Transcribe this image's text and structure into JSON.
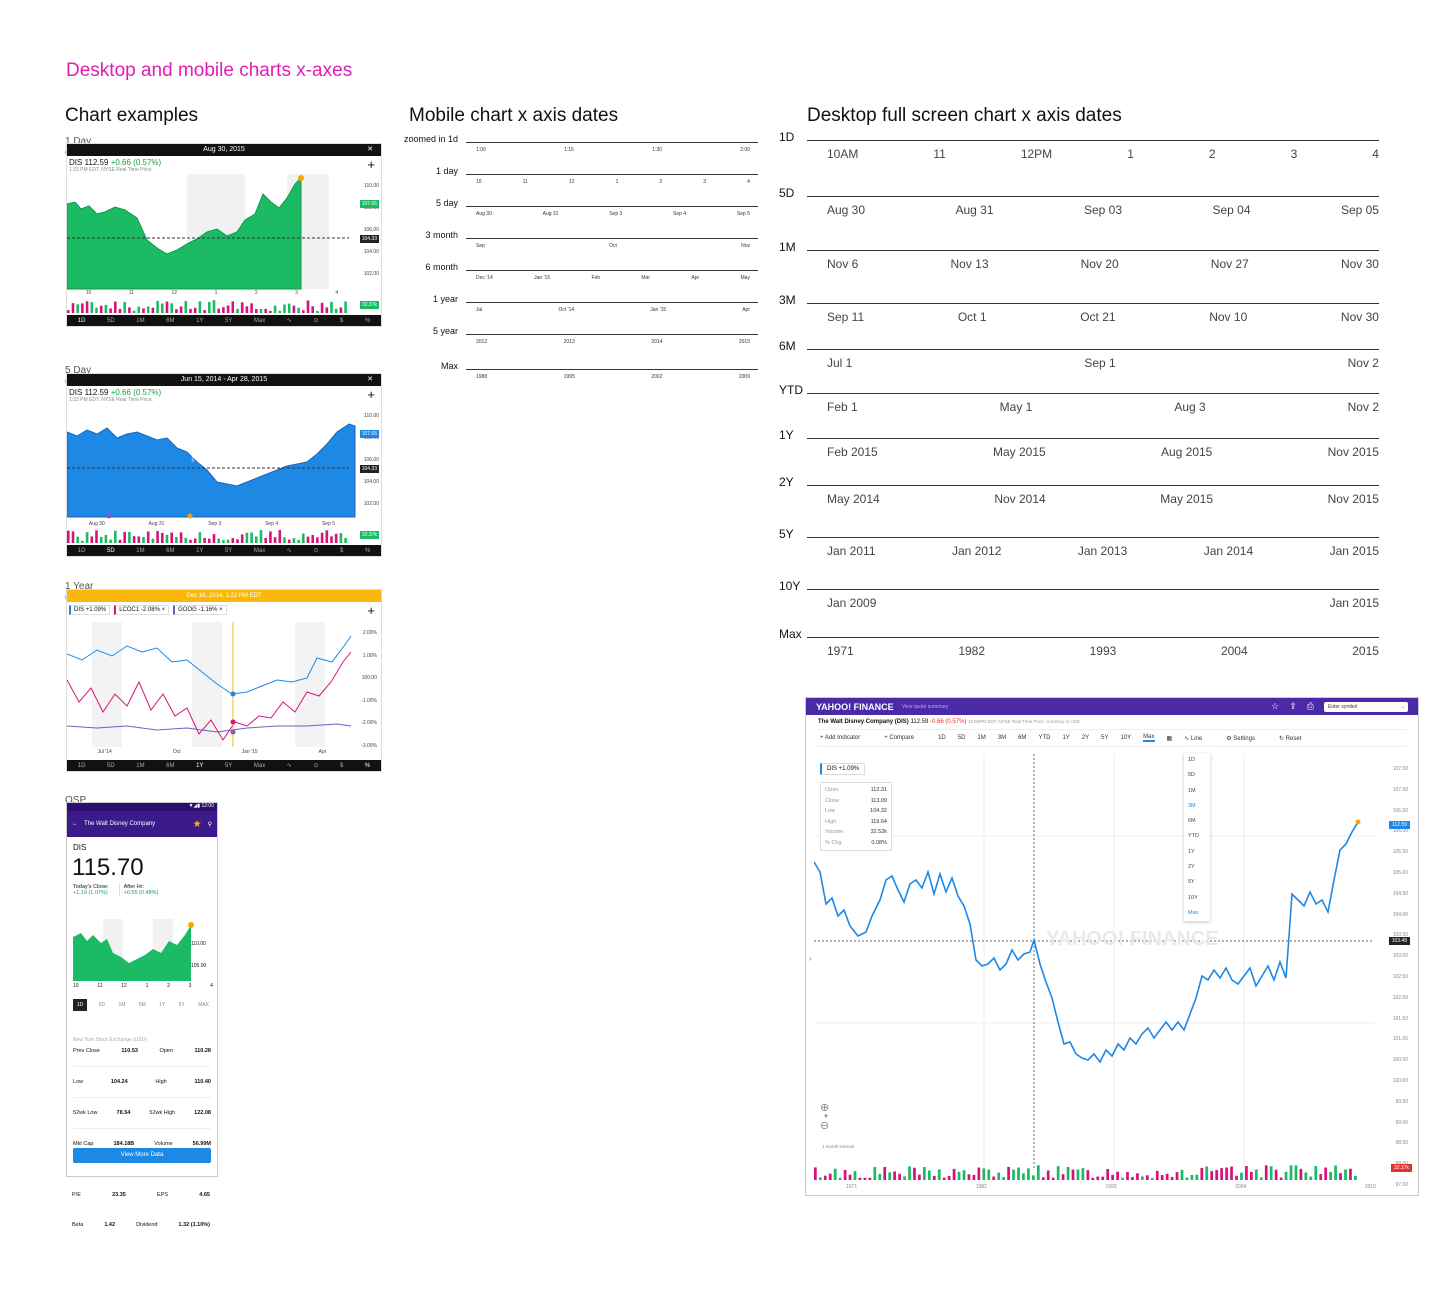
{
  "page_title": "Desktop and mobile charts x-axes",
  "sections": {
    "examples": "Chart examples",
    "mobile": "Mobile chart x axis dates",
    "desktop": "Desktop full screen chart x axis dates"
  },
  "examples": {
    "labels": [
      "1 Day chart",
      "5 Day chart",
      "1 Year chart",
      "OSP"
    ],
    "ex1": {
      "title": "Aug 30, 2015",
      "ticker": "DIS",
      "price": "112.59",
      "change": "+0.66 (0.57%)",
      "subline": "1:33 PM EDT. NYSE Real Time Price.",
      "yticks": [
        "110.00",
        "108.00",
        "106.00",
        "104.00",
        "102.00",
        "100.00"
      ],
      "current_price_tag": "107.65",
      "prev_close_tag": "104.33",
      "volume_tag": "32.37k",
      "xticks": [
        "10",
        "11",
        "12",
        "1",
        "2",
        "3",
        "4"
      ],
      "ranges": [
        "1D",
        "5D",
        "1M",
        "6M",
        "1Y",
        "5Y",
        "Max",
        "$",
        "%"
      ]
    },
    "ex2": {
      "title": "Jun 15, 2014 - Apr 28, 2015",
      "ticker": "DIS",
      "price": "112.59",
      "change": "+0.66 (0.57%)",
      "subline": "1:33 PM EDT. NYSE Real Time Price.",
      "yticks": [
        "110.00",
        "108.00",
        "106.00",
        "104.00",
        "102.00",
        "100.00"
      ],
      "current_price_tag": "107.65",
      "prev_close_tag": "104.33",
      "volume_tag": "32.37k",
      "xticks": [
        "Aug 30",
        "Aug 31",
        "Sep 3",
        "Sep 4",
        "Sep 5"
      ],
      "ranges": [
        "1D",
        "5D",
        "1M",
        "6M",
        "1Y",
        "5Y",
        "Max",
        "$",
        "%"
      ],
      "watermark": "YAHOO!"
    },
    "ex3": {
      "title": "Dec 16, 2014, 1:22 PM EDT",
      "chips": [
        {
          "sym": "DIS",
          "val": "+1.09%",
          "color": "#1e88e5"
        },
        {
          "sym": "LCOC1",
          "val": "-2.08%",
          "color": "#d6137a"
        },
        {
          "sym": "GOOG",
          "val": "-1.16%",
          "color": "#7e57c2"
        }
      ],
      "yticks": [
        "2.00%",
        "1.00%",
        "100.00",
        "-1.00%",
        "-2.00%",
        "-3.00%"
      ],
      "xticks": [
        "Jul '14",
        "Oct",
        "Jan '15",
        "Apr"
      ],
      "ranges": [
        "1D",
        "5D",
        "1M",
        "6M",
        "1Y",
        "5Y",
        "Max",
        "$",
        "%"
      ]
    },
    "ex4": {
      "status_time": "12:00",
      "header_title": "The Walt Disney Company",
      "ticker": "DIS",
      "price": "115.70",
      "todays_close_label": "Today's Close:",
      "todays_close": "+1.19 (1.07%)",
      "after_hours_label": "After Hr:",
      "after_hours": "+0.55 (0.48%)",
      "yticks": [
        "110.00",
        "105.00"
      ],
      "xticks": [
        "10",
        "11",
        "12",
        "1",
        "2",
        "3",
        "4"
      ],
      "ranges": [
        "1D",
        "5D",
        "1M",
        "6M",
        "1Y",
        "5Y",
        "MAX"
      ],
      "note": "New York Stock Exchange (USD)",
      "stats": [
        [
          "Prev Close",
          "110.53",
          "Open",
          "110.28"
        ],
        [
          "Low",
          "104.24",
          "High",
          "110.40"
        ],
        [
          "52wk Low",
          "78.54",
          "52wk High",
          "122.08"
        ],
        [
          "Mkt Cap",
          "184.18B",
          "Volume",
          "56.99M"
        ]
      ],
      "button": "View More Data",
      "stats_below": [
        [
          "P/E",
          "23.35",
          "EPS",
          "4.65"
        ],
        [
          "Beta",
          "1.42",
          "Dividend",
          "1.32 (1.10%)"
        ]
      ]
    }
  },
  "mobile_axes": [
    {
      "label": "zoomed in 1d",
      "ticks": [
        "1:00",
        "1:15",
        "1:30",
        "2:00"
      ]
    },
    {
      "label": "1 day",
      "ticks": [
        "10",
        "11",
        "12",
        "1",
        "2",
        "3",
        "4"
      ]
    },
    {
      "label": "5 day",
      "ticks": [
        "Aug 30",
        "Aug 31",
        "Sep 3",
        "Sep 4",
        "Sep 5"
      ]
    },
    {
      "label": "3 month",
      "ticks": [
        "Sep",
        "Oct",
        "Nov"
      ]
    },
    {
      "label": "6 month",
      "ticks": [
        "Dec '14",
        "Jan '15",
        "Feb",
        "Mar",
        "Apr",
        "May"
      ]
    },
    {
      "label": "1 year",
      "ticks": [
        "Jul",
        "Oct '14",
        "Jan '15",
        "Apr"
      ]
    },
    {
      "label": "5 year",
      "ticks": [
        "2012",
        "2013",
        "2014",
        "2015"
      ]
    },
    {
      "label": "Max",
      "ticks": [
        "1988",
        "1995",
        "2002",
        "2009"
      ]
    }
  ],
  "desktop_axes": [
    {
      "label": "1D",
      "ticks": [
        "10AM",
        "11",
        "12PM",
        "1",
        "2",
        "3",
        "4"
      ]
    },
    {
      "label": "5D",
      "ticks": [
        "Aug 30",
        "Aug 31",
        "Sep 03",
        "Sep 04",
        "Sep 05"
      ]
    },
    {
      "label": "1M",
      "ticks": [
        "Nov 6",
        "Nov 13",
        "Nov 20",
        "Nov 27",
        "Nov 30"
      ]
    },
    {
      "label": "3M",
      "ticks": [
        "Sep 11",
        "Oct 1",
        "Oct 21",
        "Nov 10",
        "Nov 30"
      ]
    },
    {
      "label": "6M",
      "ticks": [
        "Jul 1",
        "Sep 1",
        "Nov 2"
      ]
    },
    {
      "label": "YTD",
      "ticks": [
        "Feb 1",
        "May 1",
        "Aug 3",
        "Nov 2"
      ]
    },
    {
      "label": "1Y",
      "ticks": [
        "Feb 2015",
        "May 2015",
        "Aug 2015",
        "Nov 2015"
      ]
    },
    {
      "label": "2Y",
      "ticks": [
        "May 2014",
        "Nov 2014",
        "May 2015",
        "Nov 2015"
      ]
    },
    {
      "label": "5Y",
      "ticks": [
        "Jan 2011",
        "Jan 2012",
        "Jan 2013",
        "Jan 2014",
        "Jan 2015"
      ]
    },
    {
      "label": "10Y",
      "ticks": [
        "Jan 2009",
        "Jan 2015"
      ]
    },
    {
      "label": "Max",
      "ticks": [
        "1971",
        "1982",
        "1993",
        "2004",
        "2015"
      ]
    }
  ],
  "fullscreen": {
    "brand": "YAHOO! FINANCE",
    "view_link": "View quote summary",
    "search_placeholder": "Enter symbol",
    "company": "The Walt Disney Company (DIS)",
    "price": "112.59",
    "change": "-0.66 (0.57%)",
    "subline": "12:55PM EDT. NYSE Real Time Price. Currency in USD.",
    "toolbar": [
      "Add Indicator",
      "Compare",
      "1D",
      "5D",
      "1M",
      "3M",
      "6M",
      "YTD",
      "1Y",
      "2Y",
      "5Y",
      "10Y",
      "Max",
      "Line",
      "Settings",
      "Reset"
    ],
    "chip": "DIS +1.09%",
    "ohlc": [
      [
        "Open",
        "112.31"
      ],
      [
        "Close",
        "113.09"
      ],
      [
        "Low",
        "104.32"
      ],
      [
        "High",
        "119.64"
      ],
      [
        "Volume",
        "32.52k"
      ],
      [
        "% Chg",
        "0.08%"
      ]
    ],
    "dropdown": [
      "1D",
      "5D",
      "1M",
      "3M",
      "6M",
      "YTD",
      "1Y",
      "2Y",
      "5Y",
      "10Y",
      "Max"
    ],
    "yticks": [
      "107.50",
      "107.00",
      "106.50",
      "106.00",
      "105.50",
      "105.00",
      "104.50",
      "104.00",
      "103.50",
      "103.00",
      "102.50",
      "102.00",
      "101.50",
      "101.00",
      "100.50",
      "100.00",
      "99.50",
      "99.00",
      "98.50",
      "98.00",
      "97.00"
    ],
    "price_tag": "112.59",
    "cross_tag": "103.48",
    "volume_tag": "32.37k",
    "xticks": [
      "1971",
      "1982",
      "1993",
      "2004",
      "2015"
    ],
    "interval": "1 month interval",
    "watermark": "YAHOO! FINANCE"
  }
}
